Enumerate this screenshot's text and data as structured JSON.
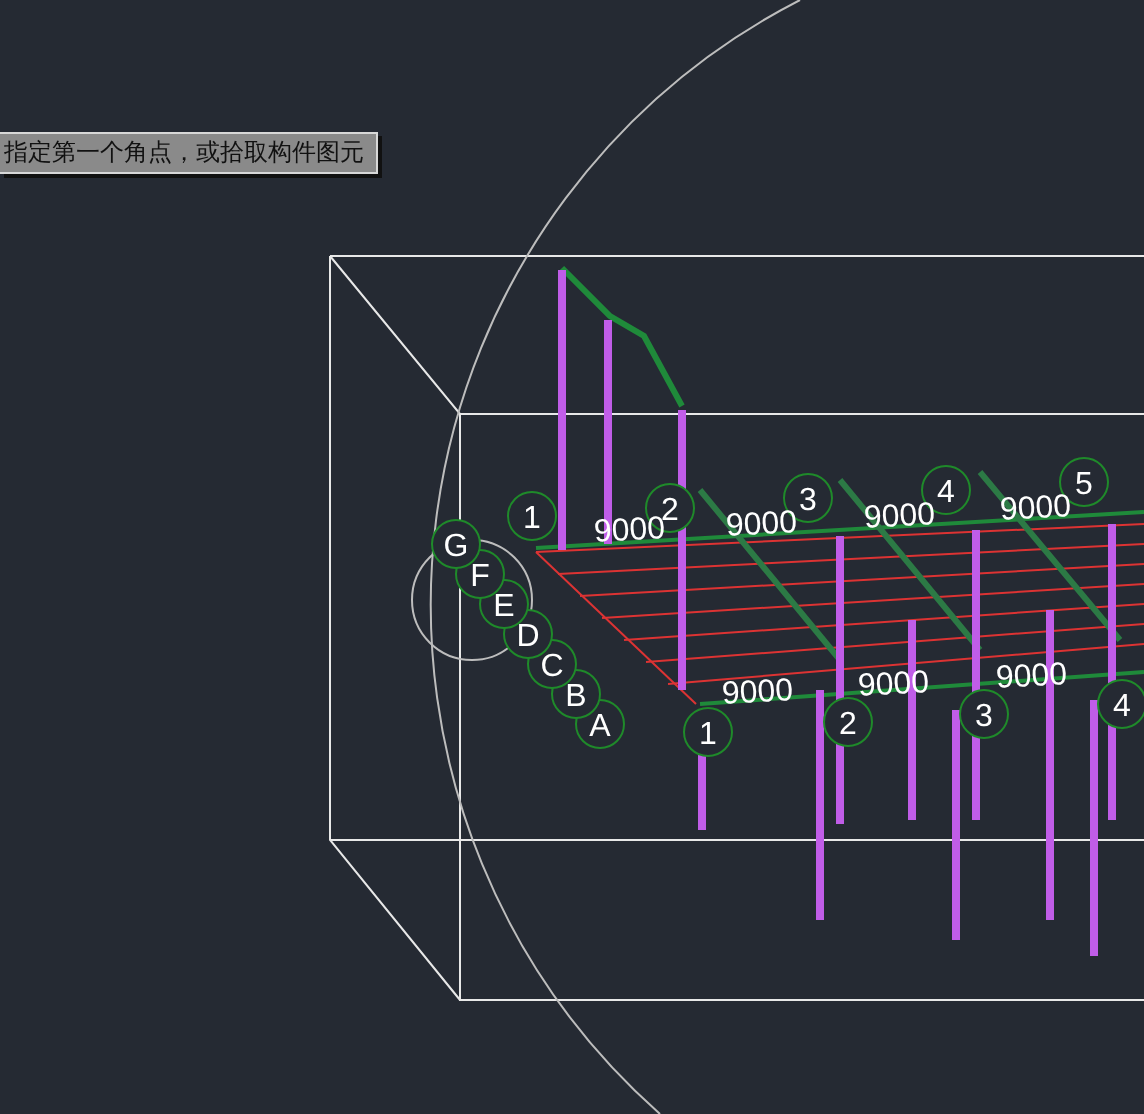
{
  "command_prompt": {
    "text": "指定第一个角点，或拾取构件图元"
  },
  "top_axes": [
    {
      "label": "1"
    },
    {
      "label": "2"
    },
    {
      "label": "3"
    },
    {
      "label": "4"
    },
    {
      "label": "5"
    }
  ],
  "top_dimensions": [
    "9000",
    "9000",
    "9000",
    "9000"
  ],
  "bottom_axes": [
    {
      "label": "1"
    },
    {
      "label": "2"
    },
    {
      "label": "3"
    },
    {
      "label": "4"
    }
  ],
  "bottom_dimensions": [
    "9000",
    "9000",
    "9000"
  ],
  "side_axes": [
    {
      "label": "G"
    },
    {
      "label": "F"
    },
    {
      "label": "E"
    },
    {
      "label": "D"
    },
    {
      "label": "C"
    },
    {
      "label": "B"
    },
    {
      "label": "A"
    }
  ]
}
